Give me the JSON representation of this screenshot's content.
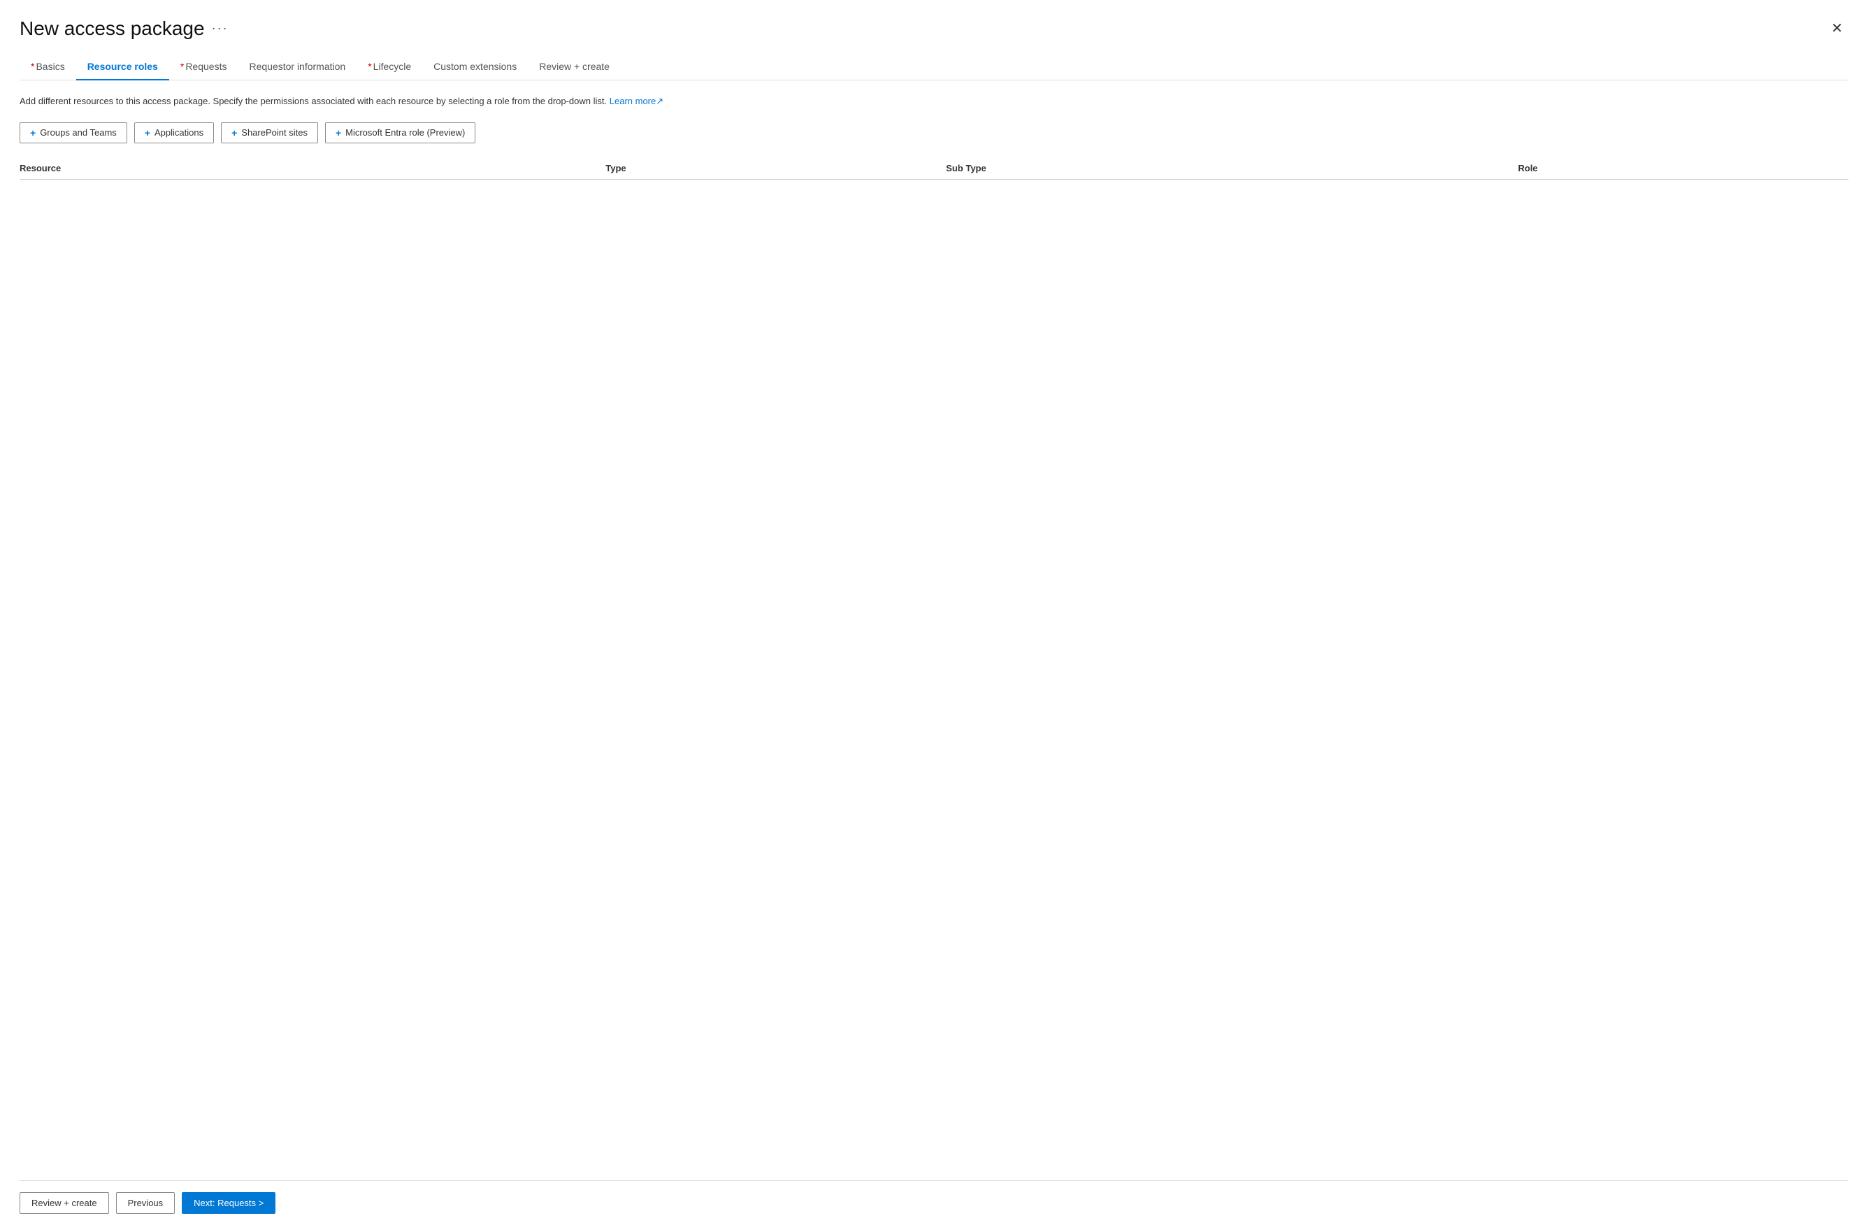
{
  "header": {
    "title": "New access package",
    "more_label": "···",
    "close_label": "✕"
  },
  "tabs": [
    {
      "id": "basics",
      "label": "Basics",
      "required": true,
      "active": false
    },
    {
      "id": "resource-roles",
      "label": "Resource roles",
      "required": false,
      "active": true
    },
    {
      "id": "requests",
      "label": "Requests",
      "required": true,
      "active": false
    },
    {
      "id": "requestor-info",
      "label": "Requestor information",
      "required": false,
      "active": false
    },
    {
      "id": "lifecycle",
      "label": "Lifecycle",
      "required": true,
      "active": false
    },
    {
      "id": "custom-extensions",
      "label": "Custom extensions",
      "required": false,
      "active": false
    },
    {
      "id": "review-create",
      "label": "Review + create",
      "required": false,
      "active": false
    }
  ],
  "description": {
    "main": "Add different resources to this access package. Specify the permissions associated with each resource by selecting a role from the drop-down list.",
    "link_label": "Learn more",
    "link_icon": "↗"
  },
  "action_buttons": [
    {
      "id": "groups-teams",
      "label": "Groups and Teams",
      "icon": "+"
    },
    {
      "id": "applications",
      "label": "Applications",
      "icon": "+"
    },
    {
      "id": "sharepoint-sites",
      "label": "SharePoint sites",
      "icon": "+"
    },
    {
      "id": "entra-role",
      "label": "Microsoft Entra role (Preview)",
      "icon": "+"
    }
  ],
  "table": {
    "columns": [
      {
        "id": "resource",
        "label": "Resource"
      },
      {
        "id": "type",
        "label": "Type"
      },
      {
        "id": "sub-type",
        "label": "Sub Type"
      },
      {
        "id": "role",
        "label": "Role"
      }
    ],
    "rows": []
  },
  "footer": {
    "review_create_label": "Review + create",
    "previous_label": "Previous",
    "next_label": "Next: Requests >"
  }
}
